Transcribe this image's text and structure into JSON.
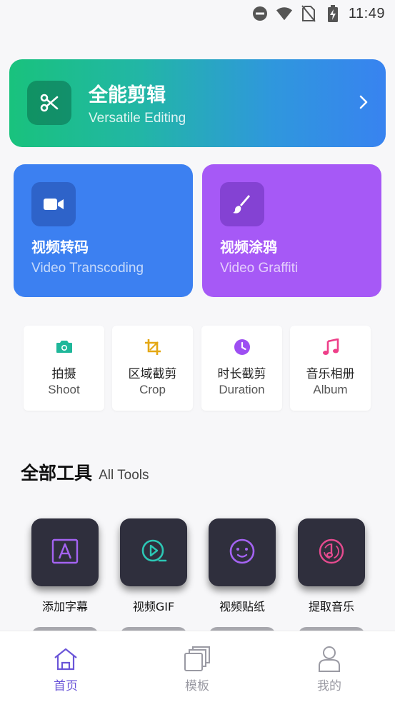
{
  "status_bar": {
    "time": "11:49"
  },
  "hero": {
    "title": "全能剪辑",
    "subtitle": "Versatile Editing",
    "icon": "scissors-icon"
  },
  "cards": [
    {
      "title": "视频转码",
      "subtitle": "Video Transcoding",
      "icon": "video-camera-icon"
    },
    {
      "title": "视频涂鸦",
      "subtitle": "Video Graffiti",
      "icon": "brush-icon"
    }
  ],
  "quick_actions": [
    {
      "label": "拍摄",
      "sub": "Shoot",
      "icon": "camera-icon",
      "color": "#1fb79a"
    },
    {
      "label": "区域截剪",
      "sub": "Crop",
      "icon": "crop-icon",
      "color": "#e4a814"
    },
    {
      "label": "时长截剪",
      "sub": "Duration",
      "icon": "clock-icon",
      "color": "#9d4ef2"
    },
    {
      "label": "音乐相册",
      "sub": "Album",
      "icon": "music-note-icon",
      "color": "#ee3f89"
    }
  ],
  "all_tools": {
    "title": "全部工具",
    "subtitle": "All Tools",
    "items": [
      {
        "label": "添加字幕",
        "icon": "subtitle-icon"
      },
      {
        "label": "视频GIF",
        "icon": "gif-play-icon"
      },
      {
        "label": "视频贴纸",
        "icon": "sticker-face-icon"
      },
      {
        "label": "提取音乐",
        "icon": "music-disc-icon"
      }
    ]
  },
  "bottom_nav": {
    "items": [
      {
        "label": "首页",
        "icon": "home-icon",
        "active": true
      },
      {
        "label": "模板",
        "icon": "template-icon",
        "active": false
      },
      {
        "label": "我的",
        "icon": "profile-icon",
        "active": false
      }
    ],
    "active_color": "#6a55d8",
    "inactive_color": "#9a9aa3"
  }
}
